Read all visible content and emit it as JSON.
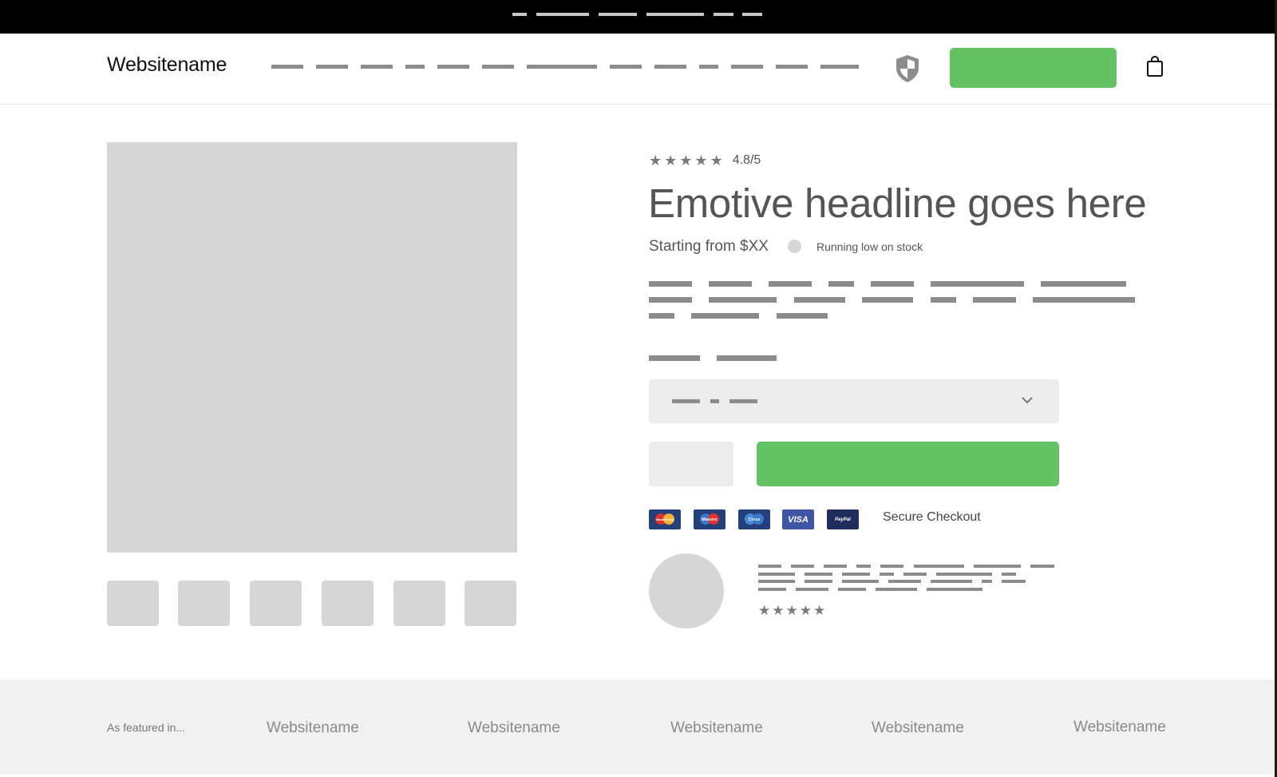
{
  "topbar": {
    "background": "#000000",
    "placeholder_dashes": 6
  },
  "header": {
    "logo": "Websitename",
    "nav_items_placeholder_count": 13,
    "icons": [
      "shield-icon",
      "shopping-bag-icon"
    ],
    "cta_button": {
      "label": "",
      "color": "#63c262"
    }
  },
  "gallery": {
    "main_image": "product-image-placeholder",
    "thumbnails_count": 6
  },
  "product": {
    "rating": {
      "stars": 5,
      "text": "4.8/5"
    },
    "headline": "Emotive headline goes here",
    "price": "Starting from $XX",
    "stock_status": "Running low on stock",
    "variant_select": {
      "placeholder": "—— - ——",
      "icon": "chevron-down-icon"
    },
    "quantity_value": "",
    "add_to_cart": {
      "label": "",
      "color": "#63c262"
    },
    "payment_methods": [
      "MasterCard",
      "Maestro",
      "Cirrus",
      "VISA",
      "PayPal"
    ],
    "secure_checkout": "Secure Checkout",
    "review": {
      "stars": 5
    }
  },
  "featured": {
    "label": "As featured in...",
    "logos": [
      "Websitename",
      "Websitename",
      "Websitename",
      "Websitename",
      "Websitename"
    ]
  },
  "colors": {
    "accent_green": "#63c262",
    "placeholder_gray": "#d6d6d6",
    "text_gray": "#555555",
    "dash_gray": "#8c8c8c",
    "footer_bg": "#f1f1f1"
  }
}
